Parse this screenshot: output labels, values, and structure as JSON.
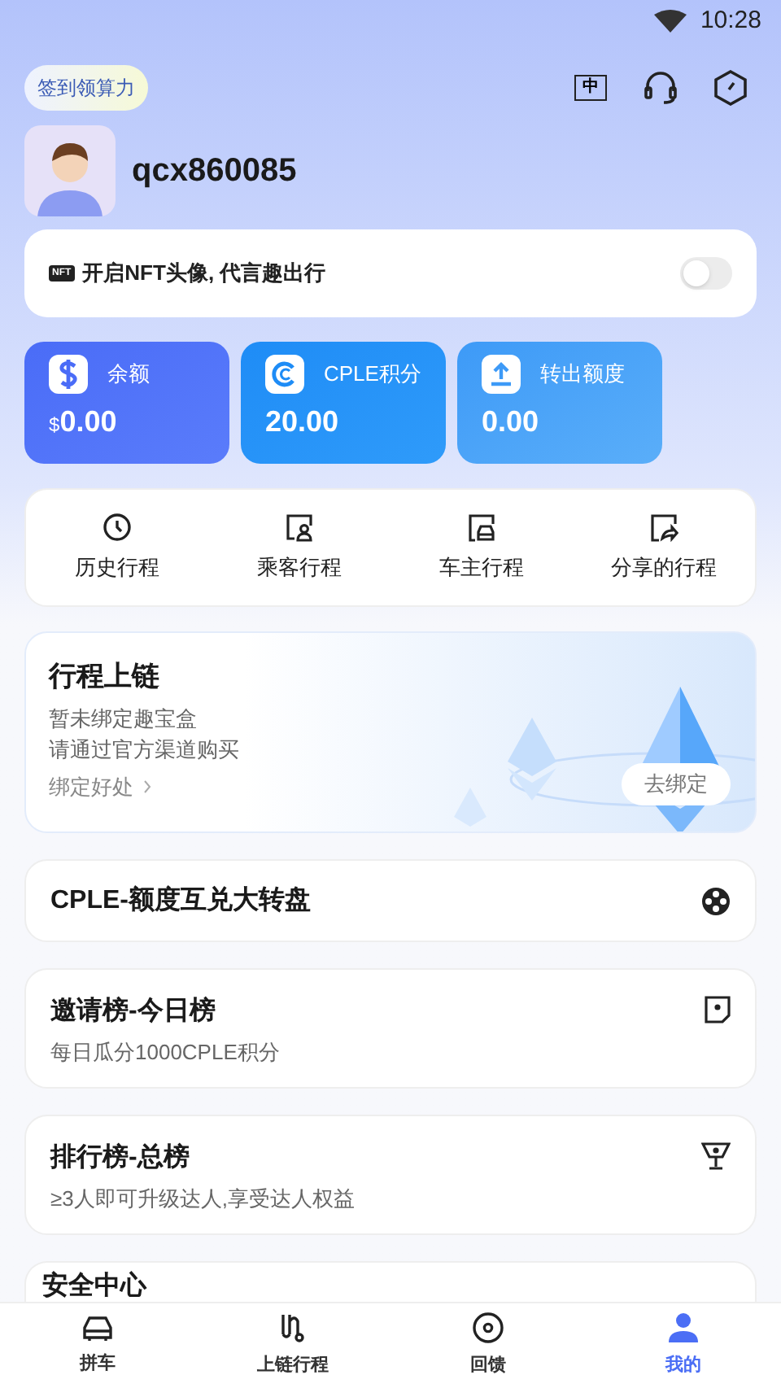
{
  "status_bar": {
    "time": "10:28"
  },
  "header": {
    "checkin": "签到领算力",
    "language": "中"
  },
  "profile": {
    "username": "qcx860085"
  },
  "nft": {
    "badge": "NFT",
    "label": "开启NFT头像, 代言趣出行",
    "on": false
  },
  "balances": [
    {
      "kind": "dollar",
      "label": "余额",
      "currency": "$",
      "value": "0.00"
    },
    {
      "kind": "coin",
      "label": "CPLE积分",
      "value": "20.00"
    },
    {
      "kind": "upload",
      "label": "转出额度",
      "value": "0.00"
    }
  ],
  "shortcuts": [
    {
      "kind": "clock",
      "label": "历史行程"
    },
    {
      "kind": "passenger",
      "label": "乘客行程"
    },
    {
      "kind": "car",
      "label": "车主行程"
    },
    {
      "kind": "share",
      "label": "分享的行程"
    }
  ],
  "chain": {
    "title": "行程上链",
    "lines": [
      "暂未绑定趣宝盒",
      "请通过官方渠道购买"
    ],
    "link": "绑定好处",
    "button": "去绑定"
  },
  "cards": [
    {
      "kind": "wheel",
      "title": "CPLE-额度互兑大转盘"
    },
    {
      "kind": "shield",
      "title": "邀请榜-今日榜",
      "subtitle": "每日瓜分1000CPLE积分"
    },
    {
      "kind": "trophy",
      "title": "排行榜-总榜",
      "subtitle": "≥3人即可升级达人,享受达人权益"
    },
    {
      "kind": "plain",
      "title": "安全中心"
    }
  ],
  "tabs": [
    {
      "kind": "car",
      "label": "拼车",
      "selected": false
    },
    {
      "kind": "route",
      "label": "上链行程",
      "selected": false
    },
    {
      "kind": "feedback",
      "label": "回馈",
      "selected": false
    },
    {
      "kind": "user",
      "label": "我的",
      "selected": true
    }
  ]
}
